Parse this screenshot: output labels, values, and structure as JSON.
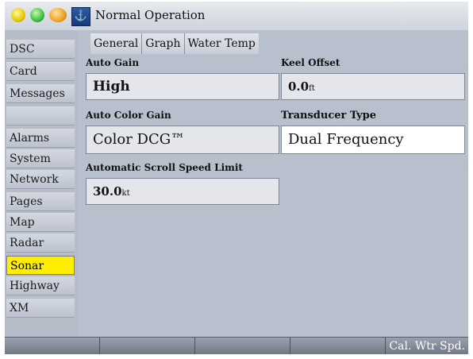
{
  "title_bar": {
    "title": "Normal Operation",
    "indicators": [
      "yellow-indicator",
      "green-indicator",
      "orange-indicator"
    ],
    "icon": "boat-mode-icon"
  },
  "sidebar": {
    "items": [
      {
        "label": "DSC",
        "state": "normal"
      },
      {
        "label": "Card",
        "state": "normal"
      },
      {
        "label": "Messages",
        "state": "normal"
      },
      {
        "label": "",
        "state": "disabled"
      },
      {
        "label": "Alarms",
        "state": "normal"
      },
      {
        "label": "System",
        "state": "normal"
      },
      {
        "label": "Network",
        "state": "normal"
      },
      {
        "label": "Pages",
        "state": "normal"
      },
      {
        "label": "Map",
        "state": "normal"
      },
      {
        "label": "Radar",
        "state": "normal"
      },
      {
        "label": "Sonar",
        "state": "selected"
      },
      {
        "label": "Highway",
        "state": "normal"
      },
      {
        "label": "XM",
        "state": "normal"
      }
    ]
  },
  "tabs": [
    {
      "label": "General"
    },
    {
      "label": "Graph"
    },
    {
      "label": "Water Temp"
    }
  ],
  "settings": {
    "auto_gain": {
      "label": "Auto Gain",
      "value": "High"
    },
    "keel_offset": {
      "label": "Keel Offset",
      "value": "0.0",
      "unit": "ft"
    },
    "auto_color_gain": {
      "label": "Auto Color Gain",
      "value": "Color DCG™"
    },
    "transducer_type": {
      "label": "Transducer Type",
      "value": "Dual Frequency"
    },
    "scroll_speed_limit": {
      "label": "Automatic Scroll Speed Limit",
      "value": "30.0",
      "unit": "kt"
    }
  },
  "soft_keys": {
    "cal_wtr_spd": "Cal. Wtr Spd."
  },
  "colors": {
    "selected_highlight": "#ffee00",
    "panel_bg": "#b9c0cd"
  }
}
